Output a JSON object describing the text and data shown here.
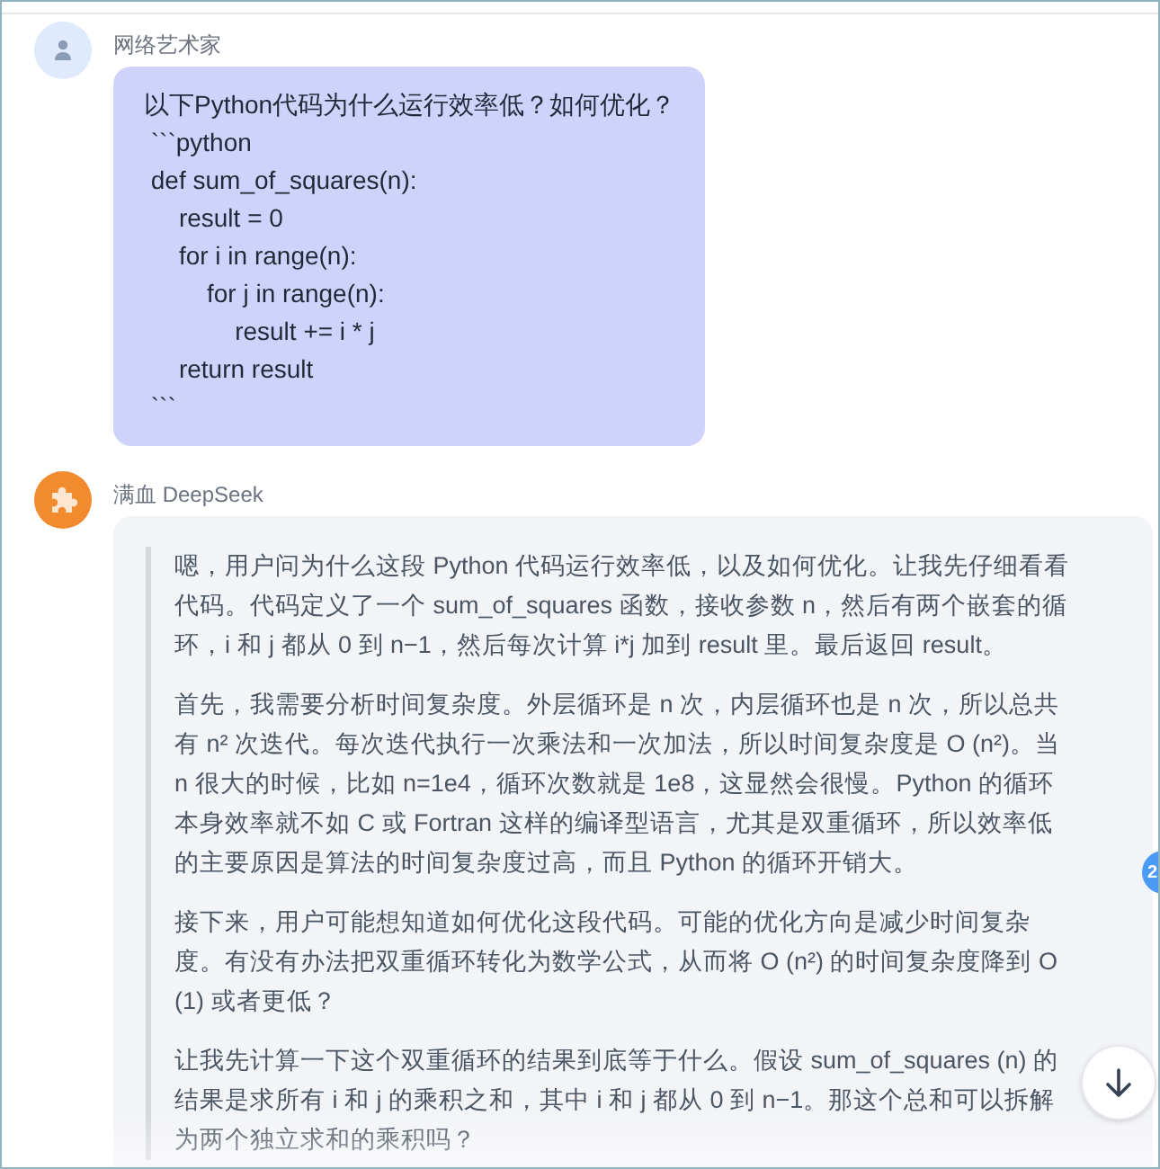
{
  "messages": [
    {
      "kind": "user",
      "author": "网络艺术家",
      "lines": [
        "以下Python代码为什么运行效率低？如何优化？",
        " ```python",
        " def sum_of_squares(n):",
        "     result = 0",
        "     for i in range(n):",
        "         for j in range(n):",
        "             result += i * j",
        "     return result",
        " ```"
      ]
    },
    {
      "kind": "assistant",
      "author": "满血 DeepSeek",
      "paragraphs": [
        "嗯，用户问为什么这段 Python 代码运行效率低，以及如何优化。让我先仔细看看代码。代码定义了一个 sum_of_squares 函数，接收参数 n，然后有两个嵌套的循环，i 和 j 都从 0 到 n−1，然后每次计算 i*j 加到 result 里。最后返回 result。",
        "首先，我需要分析时间复杂度。外层循环是 n 次，内层循环也是 n 次，所以总共有 n² 次迭代。每次迭代执行一次乘法和一次加法，所以时间复杂度是 O (n²)。当 n 很大的时候，比如 n=1e4，循环次数就是 1e8，这显然会很慢。Python 的循环本身效率就不如 C 或 Fortran 这样的编译型语言，尤其是双重循环，所以效率低的主要原因是算法的时间复杂度过高，而且 Python 的循环开销大。",
        "接下来，用户可能想知道如何优化这段代码。可能的优化方向是减少时间复杂度。有没有办法把双重循环转化为数学公式，从而将 O (n²) 的时间复杂度降到 O (1) 或者更低？",
        "让我先计算一下这个双重循环的结果到底等于什么。假设 sum_of_squares (n) 的结果是求所有 i 和 j 的乘积之和，其中 i 和 j 都从 0 到 n−1。那这个总和可以拆解为两个独立求和的乘积吗？"
      ]
    }
  ],
  "side_badge": "2"
}
